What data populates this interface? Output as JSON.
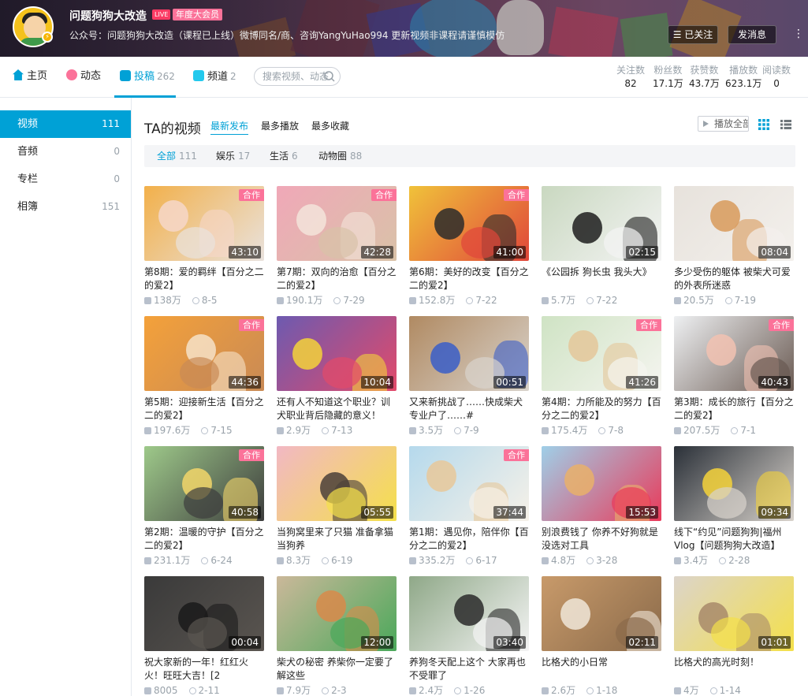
{
  "header": {
    "username": "问题狗狗大改造",
    "live_badge": "LIVE",
    "vip_badge": "年度大会员",
    "signature": "公众号：问题狗狗大改造（课程已上线）微博同名/商、咨询YangYuHao994 更新视频非课程请谨慎模仿",
    "follow_label": "已关注",
    "message_label": "发消息"
  },
  "nav": {
    "items": [
      {
        "label": "主页",
        "count": ""
      },
      {
        "label": "动态",
        "count": ""
      },
      {
        "label": "投稿",
        "count": "262"
      },
      {
        "label": "频道",
        "count": "2"
      }
    ],
    "search_placeholder": "搜索视频、动态"
  },
  "stats": [
    {
      "label": "关注数",
      "value": "82"
    },
    {
      "label": "粉丝数",
      "value": "17.1万"
    },
    {
      "label": "获赞数",
      "value": "43.7万"
    },
    {
      "label": "播放数",
      "value": "623.1万"
    },
    {
      "label": "阅读数",
      "value": "0"
    }
  ],
  "sidebar": {
    "items": [
      {
        "label": "视频",
        "count": "111"
      },
      {
        "label": "音频",
        "count": "0"
      },
      {
        "label": "专栏",
        "count": "0"
      },
      {
        "label": "相簿",
        "count": "151"
      }
    ]
  },
  "main": {
    "title": "TA的视频",
    "sorts": [
      "最新发布",
      "最多播放",
      "最多收藏"
    ],
    "play_all": "播放全部",
    "filters": [
      {
        "label": "全部",
        "count": "111"
      },
      {
        "label": "娱乐",
        "count": "17"
      },
      {
        "label": "生活",
        "count": "6"
      },
      {
        "label": "动物圈",
        "count": "88"
      }
    ],
    "coop_label": "合作",
    "videos": [
      {
        "title": "第8期：爱的羁绊【百分之二的爱2】",
        "duration": "43:10",
        "plays": "138万",
        "date": "8-5",
        "coop": true,
        "colors": [
          "#f2b04a",
          "#f6d7c9",
          "#e9e2dd"
        ]
      },
      {
        "title": "第7期：双向的治愈【百分之二的爱2】",
        "duration": "42:28",
        "plays": "190.1万",
        "date": "7-29",
        "coop": true,
        "colors": [
          "#f0a8b8",
          "#f3e4da",
          "#d9c2a8"
        ]
      },
      {
        "title": "第6期：美好的改变【百分之二的爱2】",
        "duration": "41:00",
        "plays": "152.8万",
        "date": "7-22",
        "coop": true,
        "colors": [
          "#f0c23a",
          "#2c2c2c",
          "#e0463a"
        ]
      },
      {
        "title": "《公园拆 狗长虫 我头大》",
        "duration": "02:15",
        "plays": "5.7万",
        "date": "7-22",
        "coop": false,
        "colors": [
          "#c9d8c0",
          "#1d1d1d",
          "#f4f4f4"
        ]
      },
      {
        "title": "多少受伤的躯体 被柴犬可爱的外表所迷惑",
        "duration": "08:04",
        "plays": "20.5万",
        "date": "7-19",
        "coop": false,
        "colors": [
          "#e7e2dc",
          "#d89a5a",
          "#f3f0ec"
        ]
      },
      {
        "title": "第5期：迎接新生活【百分之二的爱2】",
        "duration": "44:36",
        "plays": "197.6万",
        "date": "7-15",
        "coop": true,
        "colors": [
          "#f4a13a",
          "#f6e2c8",
          "#c98a55"
        ]
      },
      {
        "title": "还有人不知道这个职业？训犬职业背后隐藏的意义！",
        "duration": "10:04",
        "plays": "2.9万",
        "date": "7-13",
        "coop": false,
        "colors": [
          "#6d5ab0",
          "#f4d23a",
          "#e24a6a"
        ]
      },
      {
        "title": "又来新挑战了……快成柴犬专业户了……#",
        "duration": "00:51",
        "plays": "3.5万",
        "date": "7-9",
        "coop": false,
        "colors": [
          "#b08a62",
          "#3a5ec8",
          "#d9d3cc"
        ]
      },
      {
        "title": "第4期：力所能及的努力【百分之二的爱2】",
        "duration": "41:26",
        "plays": "175.4万",
        "date": "7-8",
        "coop": true,
        "colors": [
          "#cfe3c4",
          "#e4c79a",
          "#f5f5f0"
        ]
      },
      {
        "title": "第3期：成长的旅行【百分之二的爱2】",
        "duration": "40:43",
        "plays": "207.5万",
        "date": "7-1",
        "coop": true,
        "colors": [
          "#eef0f2",
          "#f2c2b2",
          "#6a5a52"
        ]
      },
      {
        "title": "第2期：温暖的守护【百分之二的爱2】",
        "duration": "40:58",
        "plays": "231.1万",
        "date": "6-24",
        "coop": true,
        "colors": [
          "#9ec98a",
          "#f2d66a",
          "#3d3d3d"
        ]
      },
      {
        "title": "当狗窝里来了只猫 准备拿猫当狗养",
        "duration": "05:55",
        "plays": "8.3万",
        "date": "6-19",
        "coop": false,
        "colors": [
          "#f2b8c4",
          "#4a3f38",
          "#f4e04a"
        ]
      },
      {
        "title": "第1期：遇见你，陪伴你【百分之二的爱2】",
        "duration": "37:44",
        "plays": "335.2万",
        "date": "6-17",
        "coop": true,
        "colors": [
          "#b5d9ec",
          "#e8c89a",
          "#f6f1e8"
        ]
      },
      {
        "title": "别浪费钱了 你养不好狗就是没选对工具",
        "duration": "15:53",
        "plays": "4.8万",
        "date": "3-28",
        "coop": false,
        "colors": [
          "#9fcfe8",
          "#e9b06a",
          "#e93a5a"
        ]
      },
      {
        "title": "线下“约见”问题狗狗|福州Vlog【问题狗狗大改造】",
        "duration": "09:34",
        "plays": "3.4万",
        "date": "2-28",
        "coop": false,
        "colors": [
          "#2a3038",
          "#f4d23a",
          "#d9d3cc"
        ]
      },
      {
        "title": "祝大家新的一年！红红火火！旺旺大吉！[2",
        "duration": "00:04",
        "plays": "8005",
        "date": "2-11",
        "coop": false,
        "colors": [
          "#3a3a3a",
          "#1a1a1a",
          "#5a5550"
        ]
      },
      {
        "title": "柴犬の秘密 养柴你一定要了解这些",
        "duration": "12:00",
        "plays": "7.9万",
        "date": "2-3",
        "coop": false,
        "colors": [
          "#cbb89a",
          "#d88a4a",
          "#4aa85a"
        ]
      },
      {
        "title": "养狗冬天配上这个 大家再也不受罪了",
        "duration": "03:40",
        "plays": "2.4万",
        "date": "1-26",
        "coop": false,
        "colors": [
          "#8fa888",
          "#2a2a2a",
          "#f4f4f4"
        ]
      },
      {
        "title": "比格犬的小日常",
        "duration": "02:11",
        "plays": "2.6万",
        "date": "1-18",
        "coop": false,
        "colors": [
          "#c89a6a",
          "#f0e6d8",
          "#8a6a4a"
        ]
      },
      {
        "title": "比格犬的高光时刻！",
        "duration": "01:01",
        "plays": "4万",
        "date": "1-14",
        "coop": false,
        "colors": [
          "#dcd4ca",
          "#a88a6a",
          "#f4e04a"
        ]
      }
    ]
  }
}
